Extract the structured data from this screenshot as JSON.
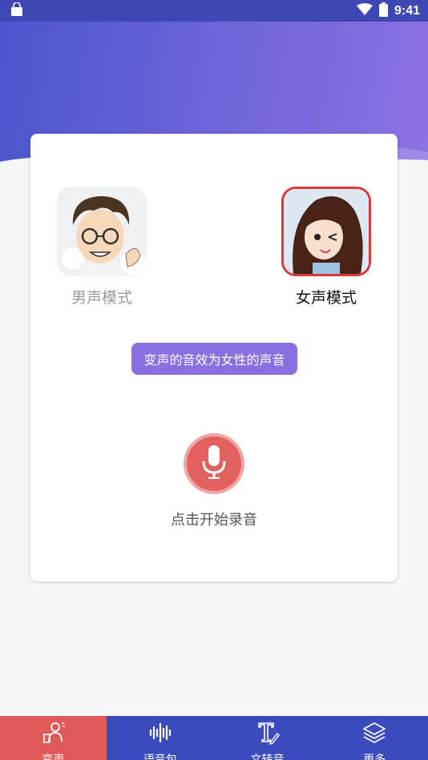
{
  "status_bar": {
    "time": "9:41",
    "icons": [
      "shopping-bag-icon",
      "wifi-icon",
      "battery-icon"
    ]
  },
  "voice_modes": {
    "male": {
      "label": "男声模式",
      "selected": false
    },
    "female": {
      "label": "女声模式",
      "selected": true
    }
  },
  "hint": "变声的音效为女性的声音",
  "record": {
    "label": "点击开始录音",
    "icon": "microphone-icon"
  },
  "tabs": [
    {
      "label": "变声",
      "icon": "voice-change-icon",
      "active": true
    },
    {
      "label": "语音包",
      "icon": "waveform-icon",
      "active": false
    },
    {
      "label": "文转音",
      "icon": "text-to-speech-icon",
      "active": false
    },
    {
      "label": "更多",
      "icon": "layers-icon",
      "active": false
    }
  ],
  "colors": {
    "header_gradient_start": "#4a55cc",
    "header_gradient_end": "#8e72e3",
    "tabbar": "#3b4bbd",
    "active_tab": "#e05a5a",
    "hint_badge": "#8a6fe0",
    "mic_button": "#e36060"
  }
}
